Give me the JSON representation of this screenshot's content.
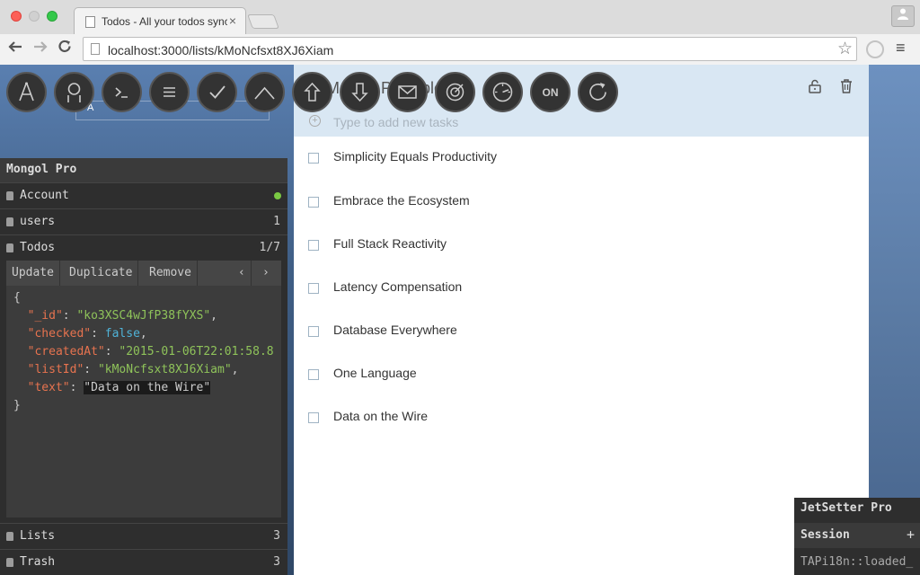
{
  "browser": {
    "tab_title": "Todos - All your todos sync",
    "tab_close": "×",
    "url": "localhost:3000/lists/kMoNcfsxt8XJ6Xiam",
    "menu_glyph": "≡"
  },
  "todo": {
    "list_title": "Meteor Principles",
    "new_task_placeholder": "Type to add new tasks",
    "tasks": [
      "Simplicity Equals Productivity",
      "Embrace the Ecosystem",
      "Full Stack Reactivity",
      "Latency Compensation",
      "Database Everywhere",
      "One Language",
      "Data on the Wire"
    ]
  },
  "toolbox": {
    "ghost_letter": "A",
    "on_label": "ON"
  },
  "mongol": {
    "title": "Mongol Pro",
    "account_label": "Account",
    "collections": [
      {
        "label": "users",
        "count": "1"
      },
      {
        "label": "Todos",
        "count": "1/7"
      }
    ],
    "footer_collections": [
      {
        "label": "Lists",
        "count": "3"
      },
      {
        "label": "Trash",
        "count": "3"
      }
    ],
    "actions": {
      "update": "Update",
      "duplicate": "Duplicate",
      "remove": "Remove",
      "prev": "‹",
      "next": "›"
    },
    "document": {
      "open_brace": "{",
      "close_brace": "}",
      "id_key": "\"_id\"",
      "id_value": "\"ko3XSC4wJfP38fYXS\"",
      "checked_key": "\"checked\"",
      "checked_value": "false",
      "createdAt_key": "\"createdAt\"",
      "createdAt_value": "\"2015-01-06T22:01:58.8",
      "listId_key": "\"listId\"",
      "listId_value": "\"kMoNcfsxt8XJ6Xiam\"",
      "text_key": "\"text\"",
      "text_value": "\"Data on the Wire\""
    }
  },
  "jetsetter": {
    "title": "JetSetter Pro",
    "session_label": "Session",
    "add_glyph": "+",
    "first_key": "TAPi18n::loaded_"
  }
}
